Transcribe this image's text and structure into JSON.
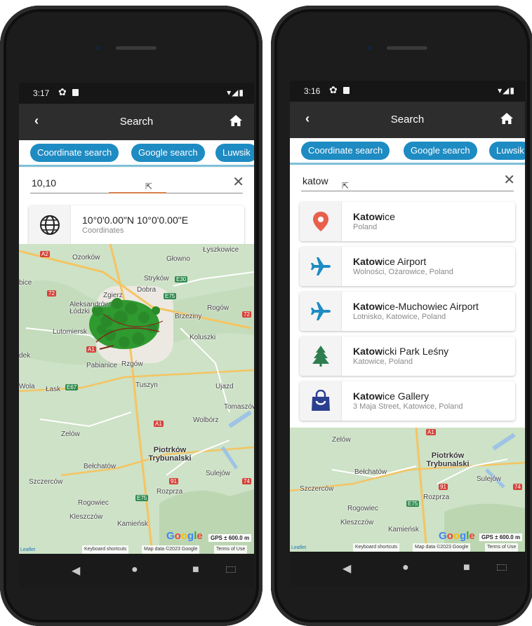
{
  "left": {
    "status": {
      "time": "3:17",
      "icons": [
        "gear-icon",
        "sd-card-icon",
        "wifi-icon",
        "signal-icon",
        "battery-icon"
      ]
    },
    "appbar": {
      "back": "‹",
      "title": "Search"
    },
    "tabs": [
      "Coordinate search",
      "Google search",
      "Luwsik"
    ],
    "search": {
      "value": "10,10"
    },
    "result": {
      "main": "10°0'0.00\"N 10°0'0.00\"E",
      "sub": "Coordinates",
      "icon": "globe-icon"
    },
    "map": {
      "labels": [
        "Ozorków",
        "Głowno",
        "Łyszkowice",
        "Stryków",
        "Zgierz",
        "Dobra",
        "Aleksandrów Łódzki",
        "Rogów",
        "Brzeziny",
        "Lutomiersk",
        "Koluszki",
        "Pabianice",
        "Rzgów",
        "Łask",
        "Tuszyn",
        "Ujazd",
        "Tomaszów Mazowiecki",
        "Wolbórz",
        "Zelów",
        "Piotrków Trybunalski",
        "Bełchatów",
        "Sulejów",
        "Szczerców",
        "Rozprza",
        "Rogowiec",
        "Kleszczów",
        "Kamieńsk",
        "bice",
        "dek",
        "Wola"
      ],
      "shields": [
        "A2",
        "E30",
        "72",
        "E75",
        "72",
        "A1",
        "E67",
        "A1",
        "91",
        "74",
        "E75"
      ],
      "google": "Google",
      "gps": "GPS ± 600.0 m",
      "attribution": [
        "Keyboard shortcuts",
        "Map data ©2023 Google",
        "Terms of Use"
      ],
      "leaflet": "Leaflet"
    }
  },
  "right": {
    "status": {
      "time": "3:16",
      "icons": [
        "gear-icon",
        "sd-card-icon",
        "wifi-icon",
        "signal-icon",
        "battery-icon"
      ]
    },
    "appbar": {
      "back": "‹",
      "title": "Search"
    },
    "tabs": [
      "Coordinate search",
      "Google search",
      "Luwsik"
    ],
    "search": {
      "value": "katow"
    },
    "results": [
      {
        "bold": "Katow",
        "rest": "ice",
        "sub": "Poland",
        "icon": "location-pin-icon"
      },
      {
        "bold": "Katow",
        "rest": "ice Airport",
        "sub": "Wolności, Ożarowice, Poland",
        "icon": "airplane-icon"
      },
      {
        "bold": "Katow",
        "rest": "ice-Muchowiec Airport",
        "sub": "Lotnisko, Katowice, Poland",
        "icon": "airplane-icon"
      },
      {
        "bold": "Katow",
        "rest": "icki Park Leśny",
        "sub": "Katowice, Poland",
        "icon": "tree-icon"
      },
      {
        "bold": "Katow",
        "rest": "ice Gallery",
        "sub": "3 Maja Street, Katowice, Poland",
        "icon": "shopping-bag-icon"
      }
    ],
    "map": {
      "labels": [
        "Zelów",
        "Piotrków Trybunalski",
        "Bełchatów",
        "Sulejów",
        "Szczerców",
        "Rozprza",
        "Rogowiec",
        "Kleszczów",
        "Kamieńsk"
      ],
      "shields": [
        "A1",
        "91",
        "74",
        "E75"
      ],
      "google": "Google",
      "gps": "GPS ± 600.0 m",
      "attribution": [
        "Keyboard shortcuts",
        "Map data ©2023 Google",
        "Terms of Use"
      ],
      "leaflet": "Leaflet"
    }
  },
  "colors": {
    "accent": "#1e8bc3",
    "appbar": "#2d2d2d",
    "pin": "#e8604c",
    "tree": "#2e7d4f",
    "bag": "#2b3f8f",
    "plane": "#1e8bc3",
    "marker": "#2a9a2a"
  }
}
